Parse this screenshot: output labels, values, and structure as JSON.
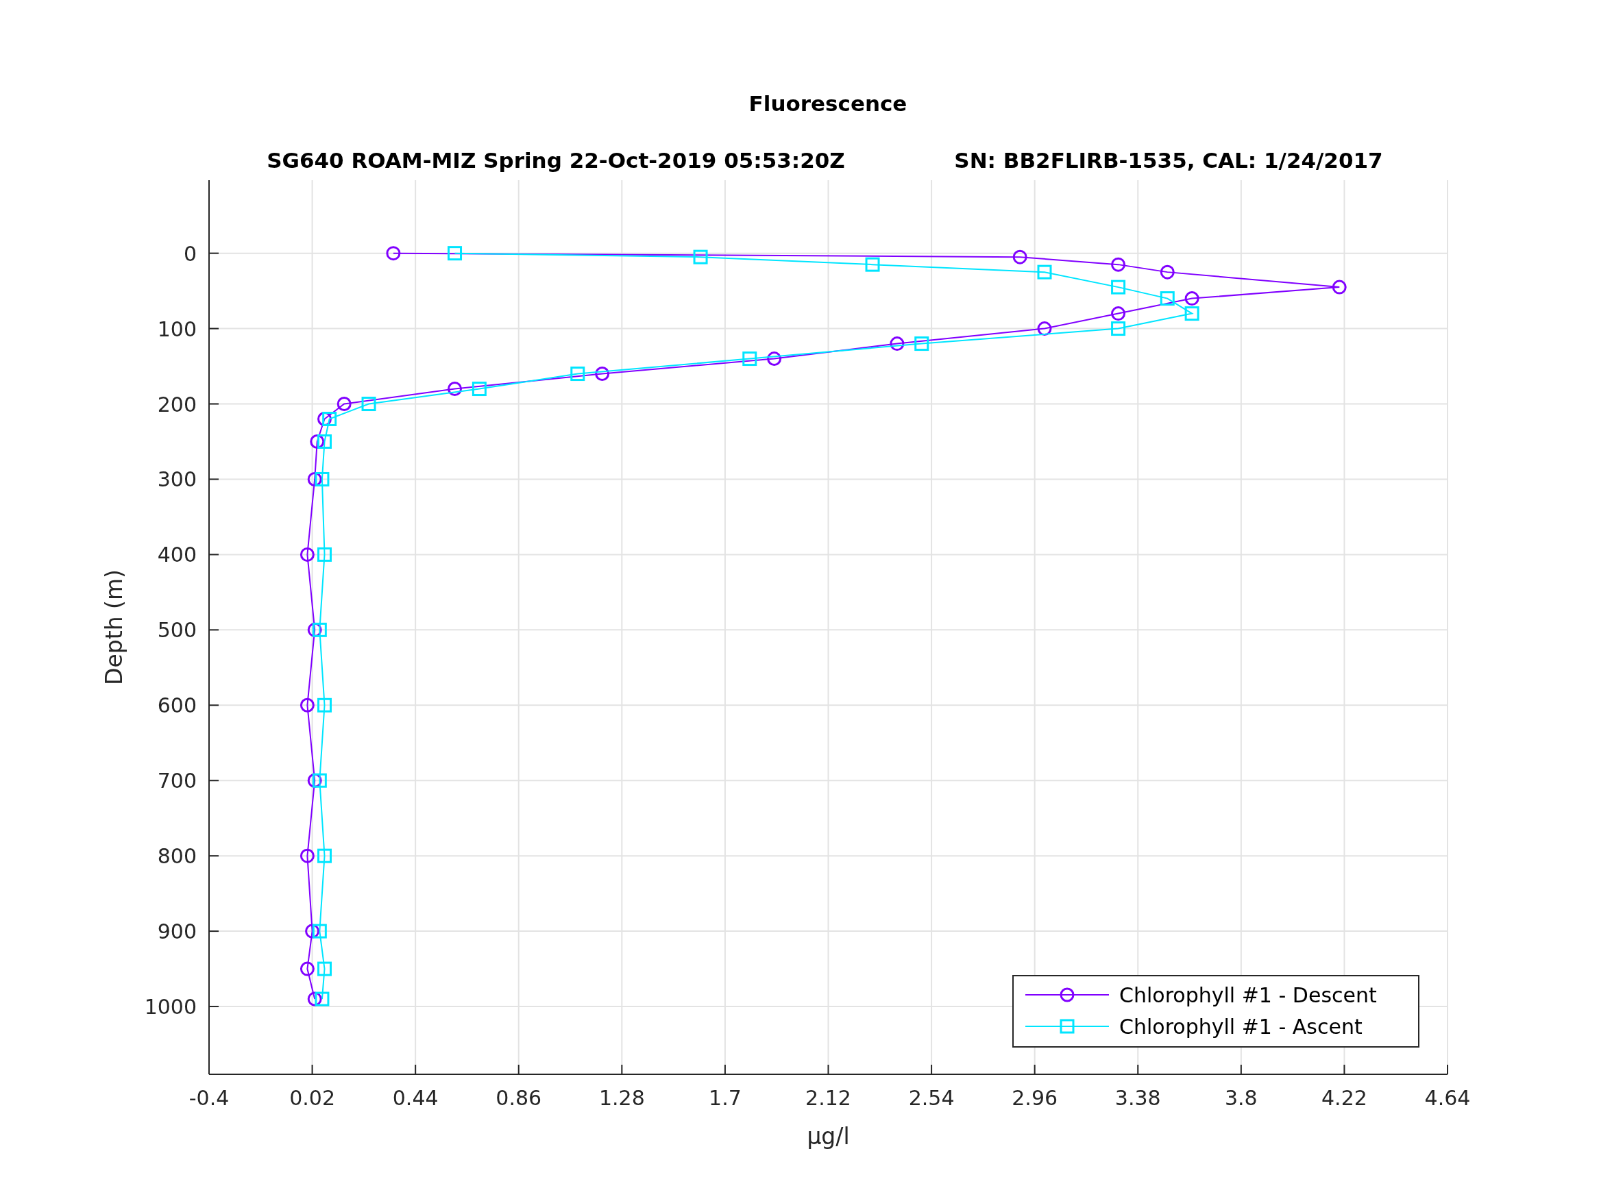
{
  "figure": {
    "title": "Fluorescence",
    "subtitle_left": "SG640 ROAM-MIZ Spring 22-Oct-2019 05:53:20Z",
    "subtitle_right": "SN: BB2FLIRB-1535, CAL: 1/24/2017",
    "chart_data": {
      "type": "line",
      "orientation": "horizontal",
      "xlabel": "μg/l",
      "grid": true,
      "legend": true,
      "ylabel": "Depth (m)",
      "x": [
        0,
        5,
        15,
        25,
        45,
        60,
        80,
        100,
        120,
        140,
        160,
        180,
        200,
        220,
        250,
        300,
        400,
        500,
        600,
        700,
        800,
        900,
        950,
        990
      ],
      "series": [
        {
          "name": "Chlorophyll #1 - Descent",
          "color": "#8000ff",
          "marker": "o",
          "values": [
            0.35,
            2.9,
            3.3,
            3.5,
            4.2,
            3.6,
            3.3,
            3.0,
            2.4,
            1.9,
            1.2,
            0.6,
            0.15,
            0.07,
            0.04,
            0.03,
            0.0,
            0.03,
            0.0,
            0.03,
            0.0,
            0.02,
            0.0,
            0.03
          ]
        },
        {
          "name": "Chlorophyll #1 - Ascent",
          "color": "#00e5ff",
          "marker": "s",
          "values": [
            0.6,
            1.6,
            2.3,
            3.0,
            3.3,
            3.5,
            3.6,
            3.3,
            2.5,
            1.8,
            1.1,
            0.7,
            0.25,
            0.09,
            0.07,
            0.06,
            0.07,
            0.05,
            0.07,
            0.05,
            0.07,
            0.05,
            0.07,
            0.06
          ]
        }
      ],
      "xlim": [
        -0.4,
        4.64
      ],
      "ylim": [
        1090,
        -97
      ],
      "xticks": [
        -0.4,
        0.02,
        0.44,
        0.86,
        1.28,
        1.7,
        2.12,
        2.54,
        2.96,
        3.38,
        3.8,
        4.22,
        4.64
      ],
      "yticks": [
        0,
        100,
        200,
        300,
        400,
        500,
        600,
        700,
        800,
        900,
        1000
      ]
    }
  }
}
